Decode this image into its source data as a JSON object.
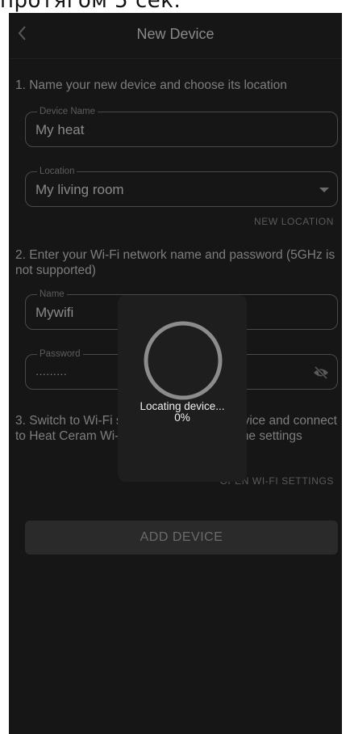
{
  "caption": "протягом 5 сек.",
  "header": {
    "title": "New Device",
    "back_icon": "chevron-left-icon"
  },
  "step1": {
    "text": "1. Name your new device and choose its location",
    "device_name": {
      "label": "Device Name",
      "value": "My heat"
    },
    "location": {
      "label": "Location",
      "value": "My living room",
      "icon": "dropdown-arrow-icon"
    },
    "new_location_label": "NEW LOCATION"
  },
  "step2": {
    "text": "2. Enter your Wi-Fi network name and password (5GHz is not supported)",
    "wifi_name": {
      "label": "Name",
      "value": "Mywifi"
    },
    "password": {
      "label": "Password",
      "value": "·········",
      "icon": "eye-off-icon"
    }
  },
  "step3": {
    "text": "3. Switch to Wi-Fi setting mode on the device and connect to Heat Ceram Wi-Fi network in your phone settings",
    "open_wifi_label": "OPEN WI-FI SETTINGS"
  },
  "add_device_label": "ADD DEVICE",
  "loader": {
    "text": "Locating device...",
    "percent": "0%"
  },
  "colors": {
    "background": "#161616",
    "overlay": "#1e1e1e",
    "spinner": "#8c8c8c"
  }
}
